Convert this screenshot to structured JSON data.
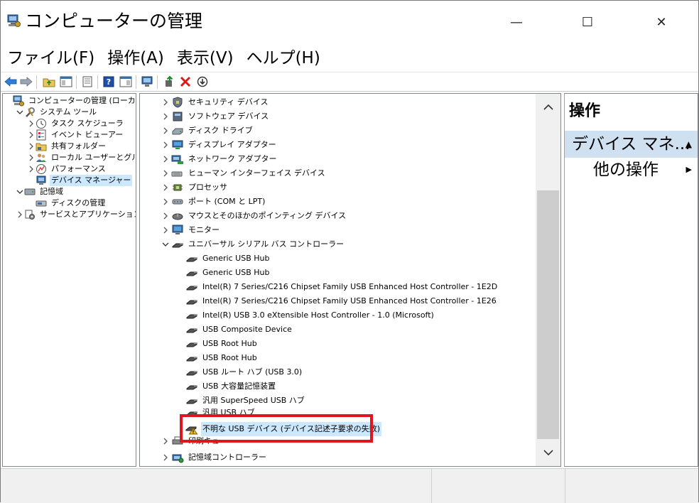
{
  "window": {
    "title": "コンピューターの管理",
    "minimize": "—",
    "maximize": "☐",
    "close": "✕"
  },
  "menu": [
    "ファイル(F)",
    "操作(A)",
    "表示(V)",
    "ヘルプ(H)"
  ],
  "left_tree": [
    {
      "label": "コンピューターの管理 (ローカル)",
      "chev": "",
      "icon": "computer-management-icon",
      "indent": 0
    },
    {
      "label": "システム ツール",
      "chev": "⌄",
      "icon": "tools-icon",
      "indent": 1
    },
    {
      "label": "タスク スケジューラ",
      "chev": "›",
      "icon": "clock-icon",
      "indent": 2
    },
    {
      "label": "イベント ビューアー",
      "chev": "›",
      "icon": "event-viewer-icon",
      "indent": 2
    },
    {
      "label": "共有フォルダー",
      "chev": "›",
      "icon": "shared-folder-icon",
      "indent": 2
    },
    {
      "label": "ローカル ユーザーとグループ",
      "chev": "›",
      "icon": "users-icon",
      "indent": 2
    },
    {
      "label": "パフォーマンス",
      "chev": "›",
      "icon": "performance-icon",
      "indent": 2
    },
    {
      "label": "デバイス マネージャー",
      "chev": "",
      "icon": "device-manager-icon",
      "indent": 2,
      "selected": true
    },
    {
      "label": "記憶域",
      "chev": "⌄",
      "icon": "storage-icon",
      "indent": 1
    },
    {
      "label": "ディスクの管理",
      "chev": "",
      "icon": "disk-management-icon",
      "indent": 2
    },
    {
      "label": "サービスとアプリケーション",
      "chev": "›",
      "icon": "services-icon",
      "indent": 1
    }
  ],
  "center_tree": [
    {
      "label": "セキュリティ デバイス",
      "chev": "›",
      "icon": "security-device-icon",
      "indent": 0
    },
    {
      "label": "ソフトウェア デバイス",
      "chev": "›",
      "icon": "software-device-icon",
      "indent": 0
    },
    {
      "label": "ディスク ドライブ",
      "chev": "›",
      "icon": "disk-drive-icon",
      "indent": 0
    },
    {
      "label": "ディスプレイ アダプター",
      "chev": "›",
      "icon": "display-adapter-icon",
      "indent": 0
    },
    {
      "label": "ネットワーク アダプター",
      "chev": "›",
      "icon": "network-adapter-icon",
      "indent": 0
    },
    {
      "label": "ヒューマン インターフェイス デバイス",
      "chev": "›",
      "icon": "hid-icon",
      "indent": 0
    },
    {
      "label": "プロセッサ",
      "chev": "›",
      "icon": "processor-icon",
      "indent": 0
    },
    {
      "label": "ポート (COM と LPT)",
      "chev": "›",
      "icon": "port-icon",
      "indent": 0
    },
    {
      "label": "マウスとそのほかのポインティング デバイス",
      "chev": "›",
      "icon": "mouse-icon",
      "indent": 0
    },
    {
      "label": "モニター",
      "chev": "›",
      "icon": "monitor-icon",
      "indent": 0
    },
    {
      "label": "ユニバーサル シリアル バス コントローラー",
      "chev": "⌄",
      "icon": "usb-icon",
      "indent": 0
    },
    {
      "label": "Generic USB Hub",
      "chev": "",
      "icon": "usb-icon",
      "indent": 1
    },
    {
      "label": "Generic USB Hub",
      "chev": "",
      "icon": "usb-icon",
      "indent": 1
    },
    {
      "label": "Intel(R) 7 Series/C216 Chipset Family USB Enhanced Host Controller - 1E2D",
      "chev": "",
      "icon": "usb-icon",
      "indent": 1
    },
    {
      "label": "Intel(R) 7 Series/C216 Chipset Family USB Enhanced Host Controller - 1E26",
      "chev": "",
      "icon": "usb-icon",
      "indent": 1
    },
    {
      "label": "Intel(R) USB 3.0 eXtensible Host Controller - 1.0 (Microsoft)",
      "chev": "",
      "icon": "usb-icon",
      "indent": 1
    },
    {
      "label": "USB Composite Device",
      "chev": "",
      "icon": "usb-icon",
      "indent": 1
    },
    {
      "label": "USB Root Hub",
      "chev": "",
      "icon": "usb-icon",
      "indent": 1
    },
    {
      "label": "USB Root Hub",
      "chev": "",
      "icon": "usb-icon",
      "indent": 1
    },
    {
      "label": "USB ルート ハブ (USB 3.0)",
      "chev": "",
      "icon": "usb-icon",
      "indent": 1
    },
    {
      "label": "USB 大容量記憶装置",
      "chev": "",
      "icon": "usb-icon",
      "indent": 1
    },
    {
      "label": "汎用 SuperSpeed USB ハブ",
      "chev": "",
      "icon": "usb-icon",
      "indent": 1
    },
    {
      "label": "汎用 USB ハブ",
      "chev": "",
      "icon": "usb-icon",
      "indent": 1,
      "clipped": true
    },
    {
      "label": "不明な USB デバイス (デバイス記述子要求の失敗)",
      "chev": "",
      "icon": "usb-warning-icon",
      "indent": 1,
      "selected": true
    },
    {
      "label": "印刷キュー",
      "chev": "›",
      "icon": "print-queue-icon",
      "indent": 0,
      "clipped": true
    },
    {
      "label": "記憶域コントローラー",
      "chev": "›",
      "icon": "storage-controller-icon",
      "indent": 0
    }
  ],
  "actions": {
    "title": "操作",
    "section": "デバイス マネ...",
    "item": "他の操作"
  },
  "colors": {
    "highlight_border": "#e0161e",
    "selection": "#cce8ff",
    "action_section_bg": "#cfe0f0"
  }
}
